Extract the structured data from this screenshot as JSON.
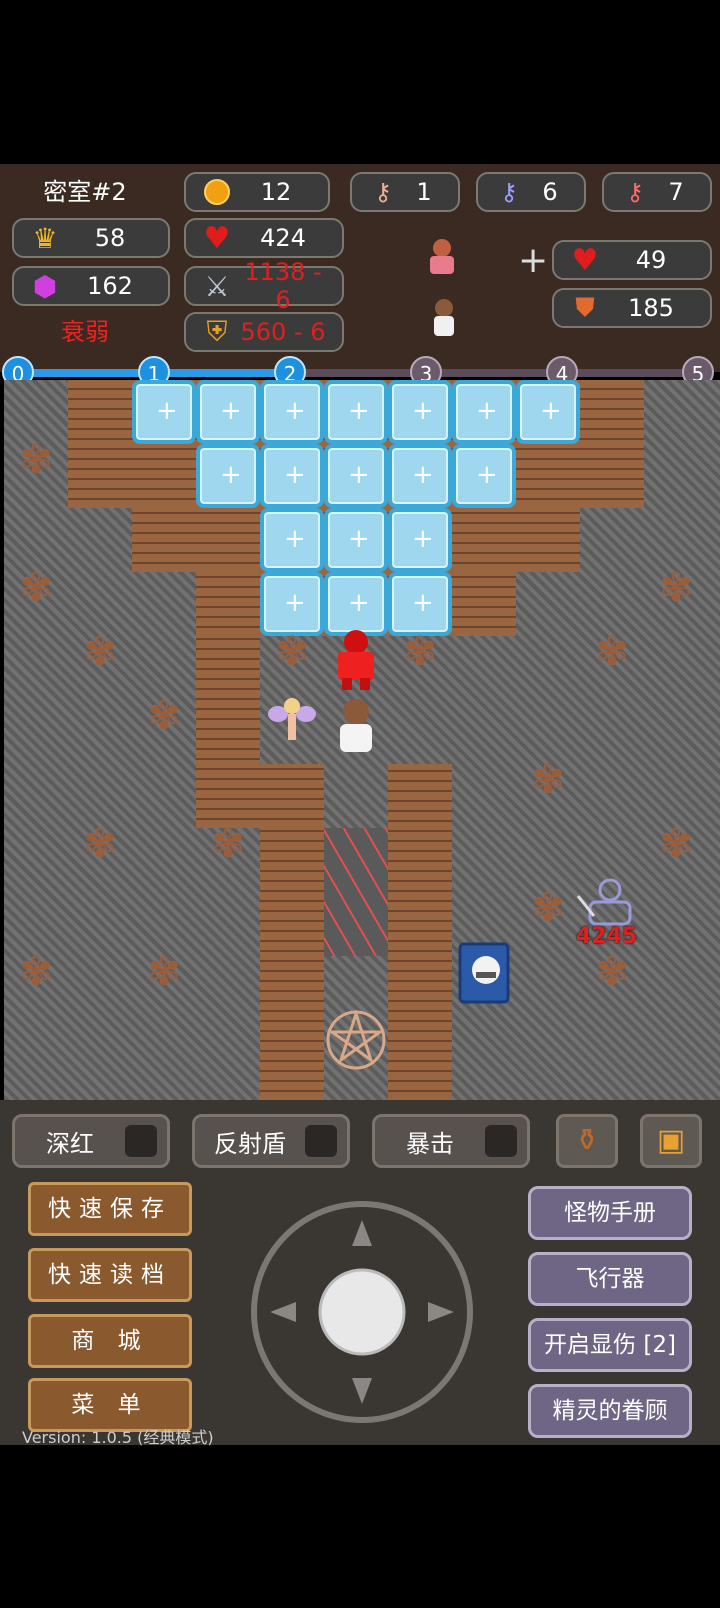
{
  "hud": {
    "floor_name": "密室#2",
    "level": "58",
    "gems": "162",
    "status": "衰弱",
    "gold": "12",
    "hp": "424",
    "atk": "1138 - 6",
    "def": "560 - 6",
    "key_yellow": "1",
    "key_blue": "6",
    "key_red": "7",
    "plus_sign": "+",
    "ally_hp": "49",
    "ally_def": "185"
  },
  "progress": {
    "nodes": [
      "0",
      "1",
      "2",
      "3",
      "4",
      "5"
    ],
    "active_upto": 2
  },
  "map": {
    "damage_label": "4245"
  },
  "toggles": {
    "t1": "深红",
    "t2": "反射盾",
    "t3": "暴击"
  },
  "left_buttons": {
    "quick_save": "快速保存",
    "quick_load": "快速读档",
    "shop": "商 城",
    "menu": "菜 单"
  },
  "right_buttons": {
    "monster_book": "怪物手册",
    "flyer": "飞行器",
    "damage_display": "开启显伤 [2]",
    "fairy_favor": "精灵的眷顾"
  },
  "version": "Version: 1.0.5 (经典模式)",
  "colors": {
    "accent_blue": "#1e90e0",
    "danger_red": "#e02020"
  }
}
